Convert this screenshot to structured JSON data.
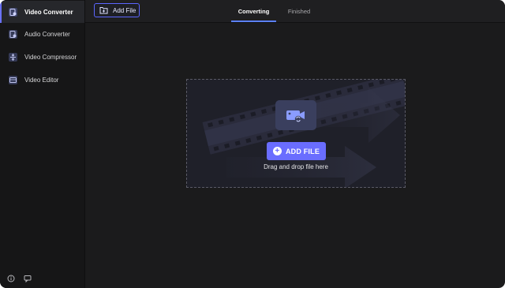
{
  "sidebar": {
    "items": [
      {
        "label": "Video Converter",
        "icon": "video-converter-icon",
        "active": true
      },
      {
        "label": "Audio Converter",
        "icon": "audio-converter-icon",
        "active": false
      },
      {
        "label": "Video Compressor",
        "icon": "video-compressor-icon",
        "active": false
      },
      {
        "label": "Video Editor",
        "icon": "video-editor-icon",
        "active": false
      }
    ],
    "bottom_icons": [
      "info-icon",
      "feedback-icon"
    ]
  },
  "topbar": {
    "add_file_label": "Add File",
    "tabs": [
      {
        "label": "Converting",
        "active": true
      },
      {
        "label": "Finished",
        "active": false
      }
    ]
  },
  "dropzone": {
    "button_label": "ADD FILE",
    "hint": "Drag and drop file here"
  },
  "colors": {
    "accent": "#6a6dff",
    "tab_underline": "#5b80ff",
    "window_bg": "#1b1b1c",
    "sidebar_bg": "#161617"
  }
}
